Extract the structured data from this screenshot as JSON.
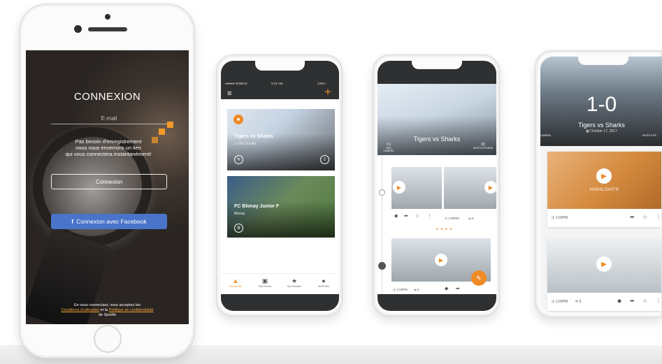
{
  "login": {
    "title": "CONNEXION",
    "email_placeholder": "E-mail",
    "info_line1": "Pas besoin d'enregistrement",
    "info_line2": "nous vous enverrons un lien",
    "info_line3": "qui vous connectera instantanément!",
    "login_button": "Connexion",
    "facebook_button": "Connexion avec Facebook",
    "terms_prefix": "En vous connectant, vous acceptez les",
    "terms_link": "Conditions d'utilisation",
    "terms_and": "et la",
    "privacy_link": "Politique de confidentialité",
    "terms_suffix": "de Sporfie"
  },
  "feed": {
    "status_carrier": "●●●●● MOBILE",
    "status_time": "9:41 AM",
    "status_battery": "100%",
    "card1_title": "Tigers vs Sharks",
    "card1_sub": "Lo Bel Scruffy",
    "card2_title": "FC Blonay Junior F",
    "card2_sub": "Blonay",
    "tabs": [
      {
        "label": "Around Me",
        "icon": "flame-icon"
      },
      {
        "label": "Past Events",
        "icon": "calendar-icon"
      },
      {
        "label": "My Favorites",
        "icon": "star-icon"
      },
      {
        "label": "Me/Profile",
        "icon": "person-icon"
      }
    ]
  },
  "game": {
    "title": "Tigers vs Sharks",
    "add_camera": "ADD CAMERA",
    "invite_stream": "INVITE A FRIEND",
    "clip1_time": "1:00PM",
    "clip1_count": "5",
    "clip2_time": "1:00PM",
    "clip2_count": "5",
    "pager": "● ● ● ●"
  },
  "score": {
    "score": "1-0",
    "match": "Tigers vs Sharks",
    "date": "October 17, 2017",
    "left_label": "CAMERA",
    "right_label": "INVITE A FR",
    "highlight_label": "HIGHLIGHTS",
    "card1_time": "1:00PM",
    "card2_time": "1:00PM",
    "card2_count": "5"
  }
}
